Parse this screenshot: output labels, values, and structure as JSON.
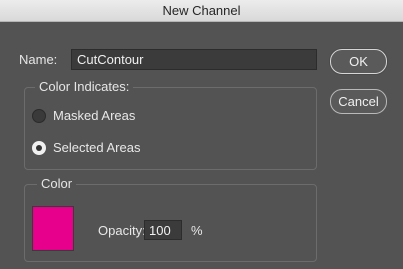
{
  "window": {
    "title": "New Channel"
  },
  "name": {
    "label": "Name:",
    "value": "CutContour"
  },
  "buttons": {
    "ok": "OK",
    "cancel": "Cancel"
  },
  "color_indicates": {
    "title": "Color Indicates:",
    "options": [
      {
        "label": "Masked Areas",
        "checked": false
      },
      {
        "label": "Selected Areas",
        "checked": true
      }
    ]
  },
  "color": {
    "title": "Color",
    "swatch_hex": "#e6008c",
    "opacity_label": "Opacity:",
    "opacity_value": "100",
    "opacity_unit": "%"
  }
}
